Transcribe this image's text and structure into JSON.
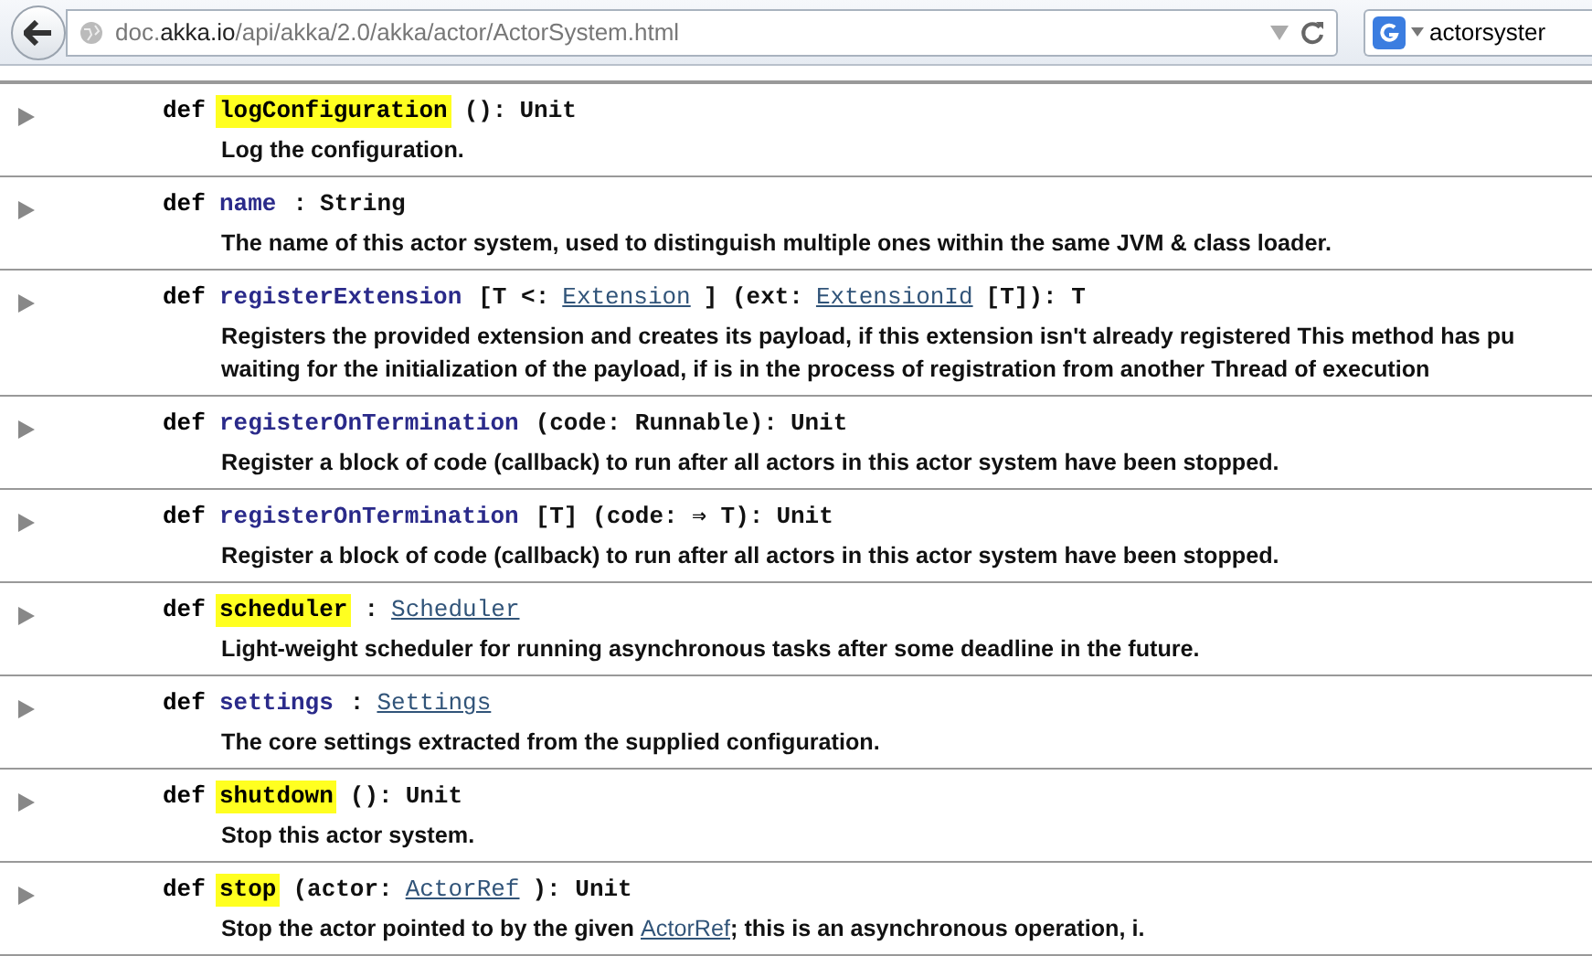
{
  "browser": {
    "url": {
      "subdomain": "doc.",
      "domain": "akka.io",
      "path": "/api/akka/2.0/akka/actor/ActorSystem.html"
    },
    "search_value": "actorsyster"
  },
  "members": [
    {
      "keyword": "def",
      "name": "logConfiguration",
      "highlighted": true,
      "signature": [
        {
          "kind": "plain",
          "text": "():"
        },
        {
          "kind": "plain",
          "text": "Unit"
        }
      ],
      "description": [
        {
          "kind": "plain",
          "text": "Log the configuration."
        }
      ]
    },
    {
      "keyword": "def",
      "name": "name",
      "highlighted": false,
      "signature": [
        {
          "kind": "plain",
          "text": ":"
        },
        {
          "kind": "plain",
          "text": "String"
        }
      ],
      "description": [
        {
          "kind": "plain",
          "text": "The name of this actor system, used to distinguish multiple ones within the same JVM & class loader."
        }
      ]
    },
    {
      "keyword": "def",
      "name": "registerExtension",
      "highlighted": false,
      "signature": [
        {
          "kind": "plain",
          "text": "[T <:"
        },
        {
          "kind": "link",
          "text": "Extension"
        },
        {
          "kind": "plain",
          "text": "] (ext:"
        },
        {
          "kind": "link",
          "text": "ExtensionId"
        },
        {
          "kind": "plain",
          "text": "[T]): T"
        }
      ],
      "description": [
        {
          "kind": "plain",
          "text": "Registers the provided extension and creates its payload, if this extension isn't already registered This method has pu"
        },
        {
          "kind": "plain",
          "text": "waiting for the initialization of the payload, if is in the process of registration from another Thread of execution"
        }
      ]
    },
    {
      "keyword": "def",
      "name": "registerOnTermination",
      "highlighted": false,
      "signature": [
        {
          "kind": "plain",
          "text": "(code: Runnable):"
        },
        {
          "kind": "plain",
          "text": "Unit"
        }
      ],
      "description": [
        {
          "kind": "plain",
          "text": "Register a block of code (callback) to run after all actors in this actor system have been stopped."
        }
      ]
    },
    {
      "keyword": "def",
      "name": "registerOnTermination",
      "highlighted": false,
      "signature": [
        {
          "kind": "plain",
          "text": "[T] (code: ⇒ T):"
        },
        {
          "kind": "plain",
          "text": "Unit"
        }
      ],
      "description": [
        {
          "kind": "plain",
          "text": "Register a block of code (callback) to run after all actors in this actor system have been stopped."
        }
      ]
    },
    {
      "keyword": "def",
      "name": "scheduler",
      "highlighted": true,
      "signature": [
        {
          "kind": "plain",
          "text": ":"
        },
        {
          "kind": "link",
          "text": "Scheduler"
        }
      ],
      "description": [
        {
          "kind": "plain",
          "text": "Light-weight scheduler for running asynchronous tasks after some deadline in the future."
        }
      ]
    },
    {
      "keyword": "def",
      "name": "settings",
      "highlighted": false,
      "signature": [
        {
          "kind": "plain",
          "text": ":"
        },
        {
          "kind": "link",
          "text": "Settings"
        }
      ],
      "description": [
        {
          "kind": "plain",
          "text": "The core settings extracted from the supplied configuration."
        }
      ]
    },
    {
      "keyword": "def",
      "name": "shutdown",
      "highlighted": true,
      "signature": [
        {
          "kind": "plain",
          "text": "():"
        },
        {
          "kind": "plain",
          "text": "Unit"
        }
      ],
      "description": [
        {
          "kind": "plain",
          "text": "Stop this actor system."
        }
      ]
    },
    {
      "keyword": "def",
      "name": "stop",
      "highlighted": true,
      "signature": [
        {
          "kind": "plain",
          "text": "(actor:"
        },
        {
          "kind": "link",
          "text": "ActorRef"
        },
        {
          "kind": "plain",
          "text": "): Unit"
        }
      ],
      "description": [
        {
          "kind": "plain",
          "text": "Stop the actor pointed to by the given"
        },
        {
          "kind": "link",
          "text": "ActorRef"
        },
        {
          "kind": "plain",
          "text": "; this is an asynchronous operation, i."
        }
      ]
    }
  ]
}
